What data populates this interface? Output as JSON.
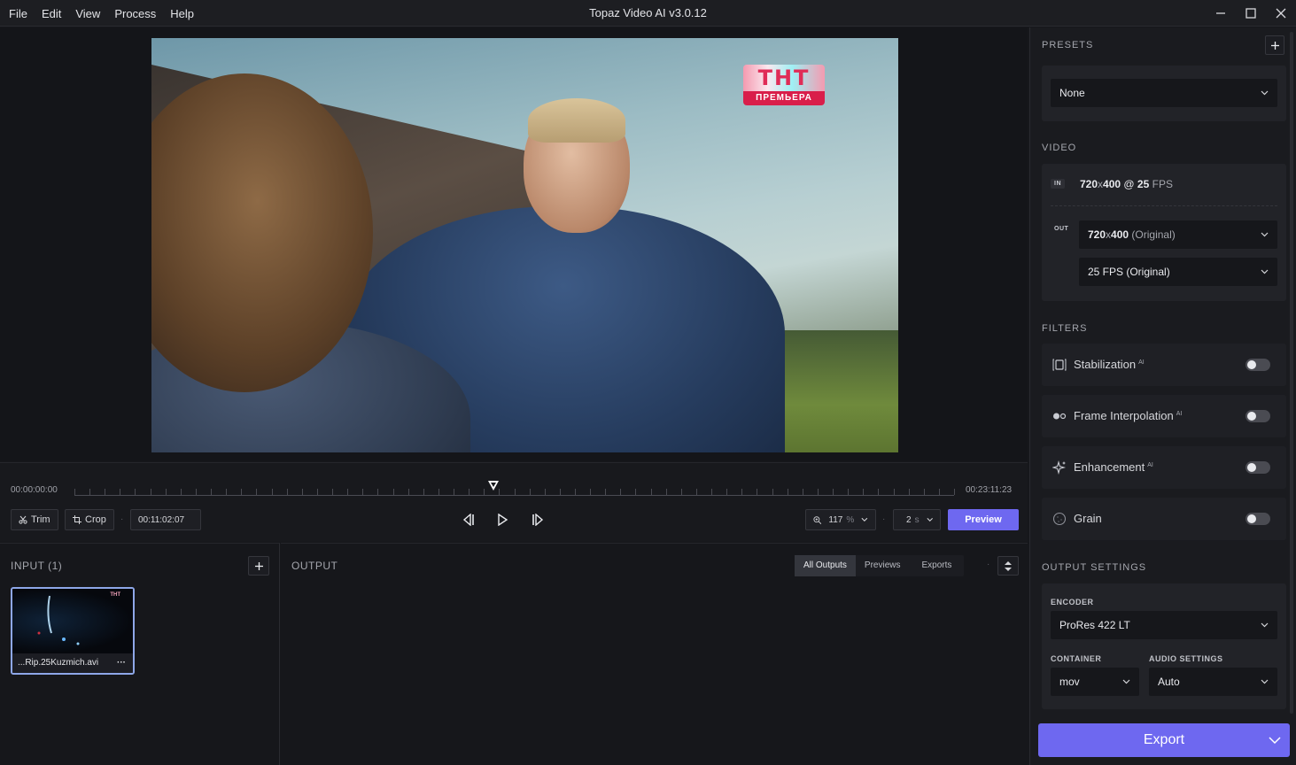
{
  "app": {
    "title": "Topaz Video AI  v3.0.12"
  },
  "menu": [
    "File",
    "Edit",
    "View",
    "Process",
    "Help"
  ],
  "viewer": {
    "logo_top": "ТНТ",
    "logo_bottom": "ПРЕМЬЕРА"
  },
  "timeline": {
    "start": "00:00:00:00",
    "end": "00:23:11:23",
    "trim_label": "Trim",
    "crop_label": "Crop",
    "current_time": "00:11:02:07",
    "zoom": "117",
    "zoom_unit": "%",
    "preview_duration": "2",
    "preview_duration_unit": "s",
    "preview_label": "Preview",
    "playhead_fraction": 0.476
  },
  "input": {
    "title": "INPUT (1)",
    "file_name": "...Rip.25Kuzmich.avi",
    "file_menu": "···",
    "thumb_logo": "ТНТ"
  },
  "output": {
    "title": "OUTPUT",
    "tabs": [
      "All Outputs",
      "Previews",
      "Exports"
    ],
    "active_tab": "All Outputs"
  },
  "sidebar": {
    "presets": {
      "title": "PRESETS",
      "value": "None"
    },
    "video": {
      "title": "VIDEO",
      "in_label": "IN",
      "in_res": "720",
      "in_x": "x",
      "in_res_h": "400",
      "in_at": " @ ",
      "in_fps": "25",
      "in_fps_unit": " FPS",
      "out_label": "OUT",
      "out_res": "720",
      "out_x": "x",
      "out_res_h": "400",
      "out_res_note": " (Original)",
      "out_fps": "25 FPS (Original)"
    },
    "filters": {
      "title": "FILTERS",
      "items": [
        {
          "label": "Stabilization",
          "ai": "AI",
          "enabled": false
        },
        {
          "label": "Frame Interpolation",
          "ai": "AI",
          "enabled": false
        },
        {
          "label": "Enhancement",
          "ai": "AI",
          "enabled": false
        },
        {
          "label": "Grain",
          "ai": "",
          "enabled": false
        }
      ]
    },
    "output_settings": {
      "title": "OUTPUT SETTINGS",
      "encoder_label": "ENCODER",
      "encoder": "ProRes 422 LT",
      "container_label": "CONTAINER",
      "container": "mov",
      "audio_label": "AUDIO SETTINGS",
      "audio": "Auto"
    },
    "export_label": "Export"
  },
  "colors": {
    "accent": "#6e68f0",
    "selection": "#8ea7e8"
  }
}
